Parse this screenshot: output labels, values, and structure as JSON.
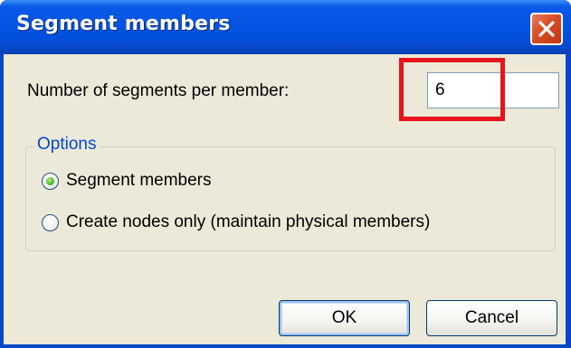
{
  "window": {
    "title": "Segment members"
  },
  "segments": {
    "label": "Number of segments per member:",
    "value": "6"
  },
  "options": {
    "legend": "Options",
    "items": [
      {
        "label": "Segment members",
        "checked": true
      },
      {
        "label": "Create nodes only (maintain physical members)",
        "checked": false
      }
    ]
  },
  "buttons": {
    "ok_label": "OK",
    "cancel_label": "Cancel"
  },
  "icons": {
    "close": "close-icon"
  },
  "colors": {
    "titlebar": "#0553e3",
    "dialog_bg": "#ece9d8",
    "highlight": "#e8141b",
    "legend_text": "#0046d5"
  }
}
